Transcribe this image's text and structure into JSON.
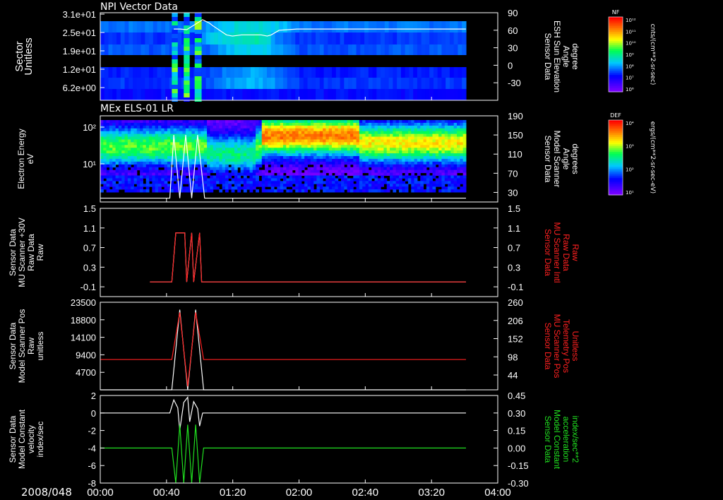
{
  "chart_data": [
    {
      "type": "heatmap",
      "title": "NPI Vector Data",
      "ylabel": [
        "Sector",
        "Unitless"
      ],
      "yticks": [
        "3.1e+01",
        "2.5e+01",
        "1.9e+01",
        "1.2e+01",
        "6.2e+00"
      ],
      "y2label": [
        "Sensor Data",
        "ESH Sun Elevation",
        "Angle",
        "degree"
      ],
      "y2ticks": [
        "90",
        "60",
        "30",
        "0",
        "-30"
      ],
      "y2lim": [
        -60,
        90
      ],
      "overlay_line": {
        "name": "ESH Sun Elevation",
        "color": "#ffffff",
        "x": [
          0.74,
          0.8,
          0.87,
          1.03,
          1.1,
          1.13,
          1.27,
          1.33,
          1.42,
          1.5,
          1.58,
          1.62,
          1.68,
          1.72,
          1.8,
          1.98,
          3.68
        ],
        "y": [
          62,
          62,
          61,
          78,
          72,
          68,
          52,
          50,
          52,
          52,
          52,
          52,
          50,
          52,
          60,
          62,
          62
        ]
      },
      "colorbar": {
        "label": "NF",
        "units": "cnts/(cm**2-sr-sec)",
        "ticks": [
          "10¹²",
          "10¹¹",
          "10¹⁰",
          "10⁹",
          "10⁸",
          "10⁷",
          "10⁶"
        ]
      }
    },
    {
      "type": "heatmap",
      "title": "MEx ELS-01 LR",
      "ylabel": [
        "Electron Energy",
        "eV"
      ],
      "yticks": [
        "10²",
        "10¹"
      ],
      "y2label": [
        "Sensor Data",
        "Model Scanner",
        "Angle",
        "degrees"
      ],
      "y2ticks": [
        "190",
        "150",
        "110",
        "70",
        "30"
      ],
      "y2lim": [
        10,
        190
      ],
      "overlay_line": {
        "name": "Model Scanner Angle",
        "color": "#ffffff",
        "x": [
          0,
          0.7,
          0.74,
          0.8,
          0.86,
          0.92,
          0.98,
          1.05,
          3.68
        ],
        "y": [
          18,
          18,
          150,
          18,
          150,
          18,
          150,
          18,
          18
        ]
      },
      "colorbar": {
        "label": "DEF",
        "units": "ergs/(cm**2-sr-sec-eV)",
        "ticks": [
          "10⁴",
          "10³",
          "10²",
          "10¹"
        ]
      }
    },
    {
      "type": "line",
      "ylabel": [
        "Sensor Data",
        "MU Scanner +30V",
        "Raw Data",
        "Raw"
      ],
      "yticks": [
        "1.5",
        "1.1",
        "0.7",
        "0.3",
        "-0.1"
      ],
      "ylim": [
        -0.3,
        1.5
      ],
      "y2label": [
        "Sensor Data",
        "MU Scanner Intl",
        "Raw Data",
        "Raw"
      ],
      "y2ticks": [
        "1.5",
        "1.1",
        "0.7",
        "0.3",
        "-0.1"
      ],
      "y2color": "#ff2020",
      "series": [
        {
          "name": "MU Scanner +30V",
          "color": "#ffffff",
          "x": [
            0.5,
            0.72,
            0.76,
            0.85,
            0.87,
            0.92,
            0.94,
            1.0,
            1.02,
            3.68
          ],
          "y": [
            0.0,
            0.0,
            1.0,
            1.0,
            0.0,
            1.0,
            0.0,
            1.0,
            0.0,
            0.0
          ]
        },
        {
          "name": "MU Scanner Intl",
          "color": "#ff2020",
          "x": [
            0.5,
            0.72,
            0.76,
            0.85,
            0.87,
            0.92,
            0.94,
            1.0,
            1.02,
            3.68
          ],
          "y": [
            0.0,
            0.0,
            1.0,
            1.0,
            0.0,
            1.0,
            0.0,
            1.0,
            0.0,
            0.0
          ]
        }
      ]
    },
    {
      "type": "line",
      "ylabel": [
        "Sensor Data",
        "Model Scanner Pos",
        "Raw",
        "unitless"
      ],
      "yticks": [
        "23500",
        "18800",
        "14100",
        "9400",
        "4700"
      ],
      "ylim": [
        0,
        23500
      ],
      "y2label": [
        "Sensor Data",
        "MU Scanner Pos",
        "Telemetry Pos",
        "Unitless"
      ],
      "y2ticks": [
        "260",
        "206",
        "152",
        "98",
        "44"
      ],
      "y2lim": [
        0,
        260
      ],
      "y2color": "#ff2020",
      "series": [
        {
          "name": "Model Scanner Pos",
          "color": "#ffffff",
          "x": [
            0,
            0.72,
            0.8,
            0.88,
            0.96,
            1.04,
            3.68
          ],
          "y": [
            0,
            0,
            21500,
            0,
            21500,
            0,
            0
          ]
        },
        {
          "name": "MU Scanner Pos",
          "color": "#ff2020",
          "x": [
            0,
            0.72,
            0.8,
            0.88,
            0.96,
            1.04,
            3.68
          ],
          "y2": [
            90,
            90,
            230,
            10,
            230,
            90,
            90
          ]
        }
      ]
    },
    {
      "type": "line",
      "ylabel": [
        "Sensor Data",
        "Model Constant",
        "velocity",
        "index/sec"
      ],
      "yticks": [
        "2",
        "0",
        "-2",
        "-4",
        "-6",
        "-8"
      ],
      "ylim": [
        -8,
        2
      ],
      "y2label": [
        "Sensor Data",
        "Model Constant",
        "acceleration",
        "index/sec**2"
      ],
      "y2ticks": [
        "0.45",
        "0.30",
        "0.15",
        "0.00",
        "-0.15",
        "-0.30"
      ],
      "y2lim": [
        -0.3,
        0.45
      ],
      "y2color": "#20e020",
      "series": [
        {
          "name": "velocity",
          "color": "#ffffff",
          "x": [
            0,
            0.7,
            0.74,
            0.78,
            0.8,
            0.84,
            0.88,
            0.9,
            0.94,
            0.98,
            1.0,
            1.03,
            3.68
          ],
          "y": [
            0,
            0,
            1.5,
            0.6,
            -2,
            1.2,
            1.8,
            -1,
            1.3,
            0.5,
            -1.5,
            0,
            0
          ]
        },
        {
          "name": "acceleration",
          "color": "#20e020",
          "x": [
            0,
            0.72,
            0.76,
            0.8,
            0.84,
            0.88,
            0.92,
            0.96,
            1.0,
            1.04,
            3.68
          ],
          "y2": [
            0.0,
            0.0,
            -0.3,
            0.2,
            -0.3,
            0.2,
            -0.3,
            0.2,
            -0.3,
            0.0,
            0.0
          ]
        }
      ]
    }
  ],
  "x_axis": {
    "date": "2008/048",
    "ticks": [
      "00:00",
      "00:40",
      "01:20",
      "02:00",
      "02:40",
      "03:20",
      "04:00"
    ],
    "range_hours": [
      0,
      4
    ]
  }
}
